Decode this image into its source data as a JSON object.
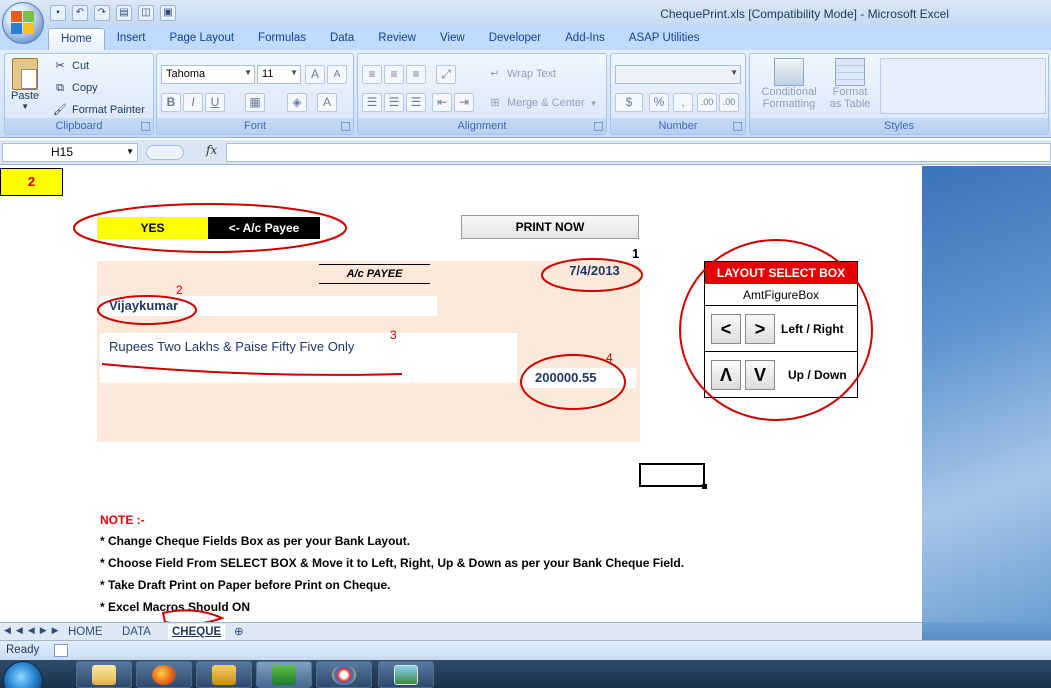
{
  "window": {
    "title": "ChequePrint.xls  [Compatibility Mode] - Microsoft Excel"
  },
  "ribbon": {
    "tabs": [
      "Home",
      "Insert",
      "Page Layout",
      "Formulas",
      "Data",
      "Review",
      "View",
      "Developer",
      "Add-Ins",
      "ASAP Utilities"
    ],
    "clipboard": {
      "paste": "Paste",
      "cut": "Cut",
      "copy": "Copy",
      "format_painter": "Format Painter",
      "label": "Clipboard"
    },
    "font": {
      "name": "Tahoma",
      "size": "11",
      "label": "Font"
    },
    "alignment": {
      "wrap_text": "Wrap Text",
      "merge_center": "Merge & Center",
      "label": "Alignment"
    },
    "number": {
      "format": "",
      "percent": "%",
      "comma": ",",
      "inc_dec": ".00",
      "label": "Number"
    },
    "styles": {
      "conditional": "Conditional",
      "formatting": "Formatting",
      "format_as": "Format",
      "as_table": "as Table",
      "label": "Styles"
    }
  },
  "formula_bar": {
    "name_box": "H15",
    "fx": "fx",
    "value": ""
  },
  "sheet": {
    "cell_value": "2",
    "yes_label": "YES",
    "payee_label": "<- A/c Payee",
    "print_button": "PRINT NOW",
    "marker_1": "1",
    "cheque": {
      "ac_payee": "A/c PAYEE",
      "date": "7/4/2013",
      "payee_name": "Vijaykumar",
      "amount_words": "Rupees Two Lakhs & Paise Fifty Five Only",
      "amount_figure": "200000.55",
      "labels": [
        "2",
        "3",
        "4"
      ]
    },
    "layout_box": {
      "title": "LAYOUT SELECT BOX",
      "selected_field": "AmtFigureBox",
      "left_btn": "<",
      "right_btn": ">",
      "left_right_label": "Left / Right",
      "up_btn": "Λ",
      "down_btn": "V",
      "up_down_label": "Up / Down"
    },
    "notes": {
      "title": "NOTE :-",
      "lines": [
        "* Change Cheque Fields Box as per your Bank Layout.",
        "* Choose Field From SELECT BOX & Move it to Left, Right, Up & Down as per your Bank Cheque Field.",
        "* Take Draft Print on Paper before Print on Cheque.",
        "* Excel Macros Should ON"
      ]
    }
  },
  "sheet_tabs": [
    "HOME",
    "DATA",
    "CHEQUE"
  ],
  "active_sheet": "CHEQUE",
  "status": {
    "text": "Ready"
  },
  "colors": {
    "accent_red": "#e60000",
    "cheque_bg": "#fde9d9",
    "yes_yellow": "#ffff00",
    "annotation_red": "#d00000"
  }
}
